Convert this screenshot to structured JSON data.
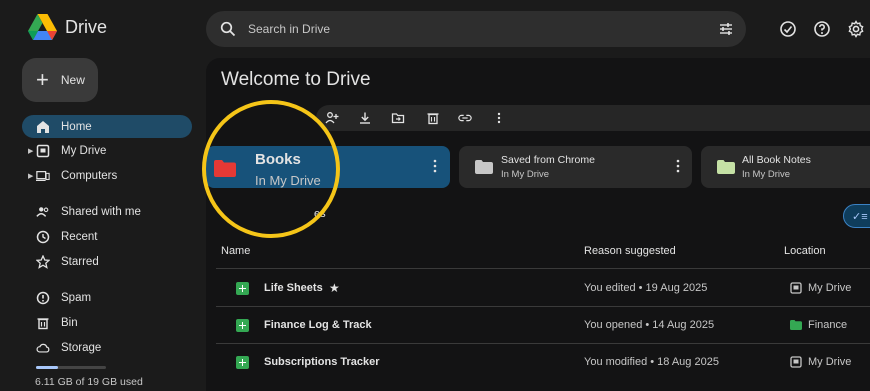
{
  "app": {
    "name": "Drive"
  },
  "new_button": {
    "label": "New"
  },
  "nav": [
    {
      "id": "home",
      "label": "Home",
      "icon": "home-icon",
      "active": true,
      "expandable": false
    },
    {
      "id": "my-drive",
      "label": "My Drive",
      "icon": "my-drive-icon",
      "active": false,
      "expandable": true
    },
    {
      "id": "computers",
      "label": "Computers",
      "icon": "computers-icon",
      "active": false,
      "expandable": true
    },
    {
      "id": "shared",
      "label": "Shared with me",
      "icon": "shared-people-icon",
      "active": false,
      "expandable": false
    },
    {
      "id": "recent",
      "label": "Recent",
      "icon": "clock-icon",
      "active": false,
      "expandable": false
    },
    {
      "id": "starred",
      "label": "Starred",
      "icon": "star-icon",
      "active": false,
      "expandable": false
    },
    {
      "id": "spam",
      "label": "Spam",
      "icon": "spam-icon",
      "active": false,
      "expandable": false
    },
    {
      "id": "bin",
      "label": "Bin",
      "icon": "trash-icon",
      "active": false,
      "expandable": false
    },
    {
      "id": "storage",
      "label": "Storage",
      "icon": "cloud-icon",
      "active": false,
      "expandable": false
    }
  ],
  "storage": {
    "text": "6.11 GB of 19 GB used",
    "used_fraction": 0.32
  },
  "search": {
    "placeholder": "Search in Drive"
  },
  "main": {
    "title": "Welcome to Drive"
  },
  "suggested_folders": [
    {
      "title": "Books",
      "subtitle": "In My Drive",
      "selected": true,
      "folder_color": "#e53935"
    },
    {
      "title": "Saved from Chrome",
      "subtitle": "In My Drive",
      "selected": false,
      "folder_color": "#c7c7c7"
    },
    {
      "title": "All Book Notes",
      "subtitle": "In My Drive",
      "selected": false,
      "folder_color": "#c5e1a5"
    }
  ],
  "section_label_partial": "es",
  "table": {
    "headers": {
      "name": "Name",
      "reason": "Reason suggested",
      "location": "Location"
    },
    "rows": [
      {
        "name": "Life Sheets",
        "starred": true,
        "reason": "You edited • 19 Aug 2025",
        "location": "My Drive",
        "location_icon": "my-drive-icon"
      },
      {
        "name": "Finance Log & Track",
        "starred": false,
        "reason": "You opened • 14 Aug 2025",
        "location": "Finance",
        "location_icon": "folder-green-icon"
      },
      {
        "name": "Subscriptions Tracker",
        "starred": false,
        "reason": "You modified • 18 Aug 2025",
        "location": "My Drive",
        "location_icon": "my-drive-icon"
      }
    ]
  },
  "colors": {
    "accent": "#a8c7fa",
    "selected_card": "#17527a",
    "active_nav": "#1f4b67",
    "highlight_ring": "#f5c518",
    "sheets_green": "#34a853"
  }
}
